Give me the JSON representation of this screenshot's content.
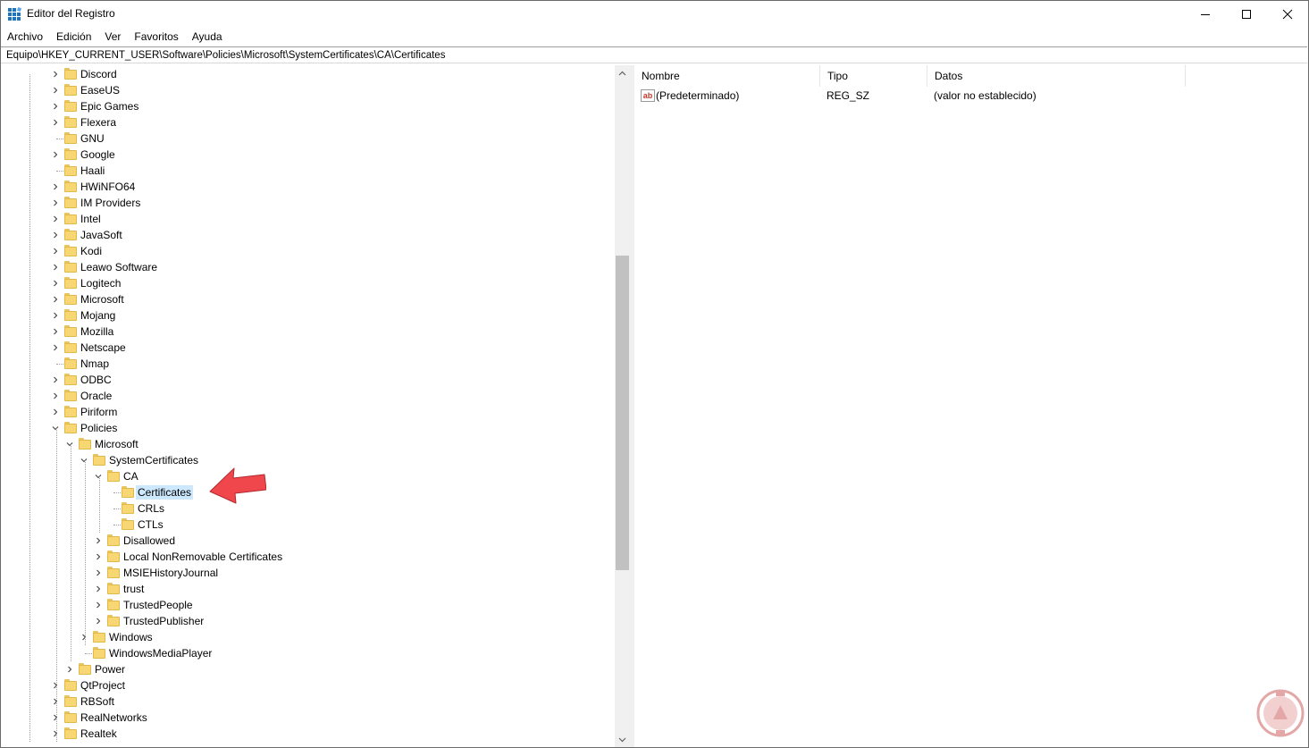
{
  "window": {
    "title": "Editor del Registro",
    "minimize_glyph": "─",
    "maximize_glyph": "☐",
    "close_glyph": "✕"
  },
  "menu": [
    "Archivo",
    "Edición",
    "Ver",
    "Favoritos",
    "Ayuda"
  ],
  "address": "Equipo\\HKEY_CURRENT_USER\\Software\\Policies\\Microsoft\\SystemCertificates\\CA\\Certificates",
  "tree": [
    {
      "label": "Discord",
      "level": 0,
      "expander": "collapsed"
    },
    {
      "label": "EaseUS",
      "level": 0,
      "expander": "collapsed"
    },
    {
      "label": "Epic Games",
      "level": 0,
      "expander": "collapsed"
    },
    {
      "label": "Flexera",
      "level": 0,
      "expander": "collapsed"
    },
    {
      "label": "GNU",
      "level": 0,
      "expander": "none"
    },
    {
      "label": "Google",
      "level": 0,
      "expander": "collapsed"
    },
    {
      "label": "Haali",
      "level": 0,
      "expander": "none"
    },
    {
      "label": "HWiNFO64",
      "level": 0,
      "expander": "collapsed"
    },
    {
      "label": "IM Providers",
      "level": 0,
      "expander": "collapsed"
    },
    {
      "label": "Intel",
      "level": 0,
      "expander": "collapsed"
    },
    {
      "label": "JavaSoft",
      "level": 0,
      "expander": "collapsed"
    },
    {
      "label": "Kodi",
      "level": 0,
      "expander": "collapsed"
    },
    {
      "label": "Leawo Software",
      "level": 0,
      "expander": "collapsed"
    },
    {
      "label": "Logitech",
      "level": 0,
      "expander": "collapsed"
    },
    {
      "label": "Microsoft",
      "level": 0,
      "expander": "collapsed"
    },
    {
      "label": "Mojang",
      "level": 0,
      "expander": "collapsed"
    },
    {
      "label": "Mozilla",
      "level": 0,
      "expander": "collapsed"
    },
    {
      "label": "Netscape",
      "level": 0,
      "expander": "collapsed"
    },
    {
      "label": "Nmap",
      "level": 0,
      "expander": "none"
    },
    {
      "label": "ODBC",
      "level": 0,
      "expander": "collapsed"
    },
    {
      "label": "Oracle",
      "level": 0,
      "expander": "collapsed"
    },
    {
      "label": "Piriform",
      "level": 0,
      "expander": "collapsed"
    },
    {
      "label": "Policies",
      "level": 0,
      "expander": "expanded"
    },
    {
      "label": "Microsoft",
      "level": 1,
      "expander": "expanded"
    },
    {
      "label": "SystemCertificates",
      "level": 2,
      "expander": "expanded"
    },
    {
      "label": "CA",
      "level": 3,
      "expander": "expanded"
    },
    {
      "label": "Certificates",
      "level": 4,
      "expander": "none",
      "selected": true
    },
    {
      "label": "CRLs",
      "level": 4,
      "expander": "none"
    },
    {
      "label": "CTLs",
      "level": 4,
      "expander": "none"
    },
    {
      "label": "Disallowed",
      "level": 3,
      "expander": "collapsed"
    },
    {
      "label": "Local NonRemovable Certificates",
      "level": 3,
      "expander": "collapsed"
    },
    {
      "label": "MSIEHistoryJournal",
      "level": 3,
      "expander": "collapsed"
    },
    {
      "label": "trust",
      "level": 3,
      "expander": "collapsed"
    },
    {
      "label": "TrustedPeople",
      "level": 3,
      "expander": "collapsed"
    },
    {
      "label": "TrustedPublisher",
      "level": 3,
      "expander": "collapsed"
    },
    {
      "label": "Windows",
      "level": 2,
      "expander": "collapsed"
    },
    {
      "label": "WindowsMediaPlayer",
      "level": 2,
      "expander": "none"
    },
    {
      "label": "Power",
      "level": 1,
      "expander": "collapsed"
    },
    {
      "label": "QtProject",
      "level": 0,
      "expander": "collapsed"
    },
    {
      "label": "RBSoft",
      "level": 0,
      "expander": "collapsed"
    },
    {
      "label": "RealNetworks",
      "level": 0,
      "expander": "collapsed"
    },
    {
      "label": "Realtek",
      "level": 0,
      "expander": "collapsed"
    }
  ],
  "values": {
    "headers": {
      "name": "Nombre",
      "type": "Tipo",
      "data": "Datos"
    },
    "rows": [
      {
        "name": "(Predeterminado)",
        "type": "REG_SZ",
        "data": "(valor no establecido)",
        "icon": "string-value-icon",
        "icon_text": "ab"
      }
    ]
  },
  "colors": {
    "selection": "#cce8ff",
    "folder": "#f7d774",
    "arrow": "#f0474c"
  }
}
